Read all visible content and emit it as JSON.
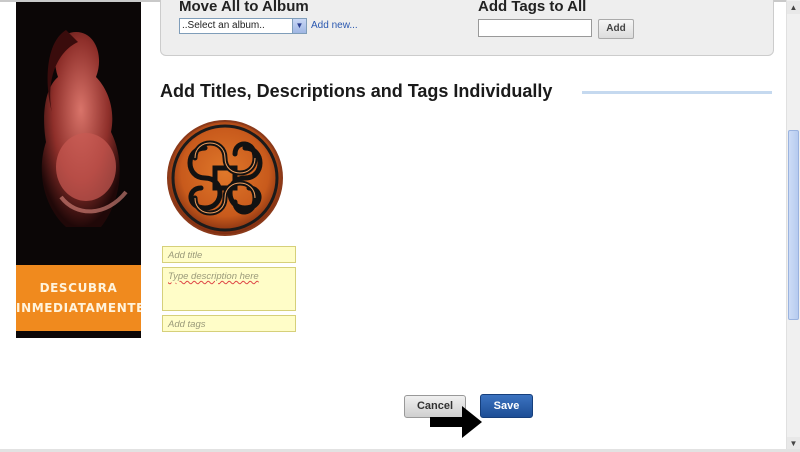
{
  "ad": {
    "line1": "DESCUBRA",
    "line2": "INMEDIATAMENTE"
  },
  "bulk": {
    "album_heading": "Move All to Album",
    "album_select_value": "..Select an album..",
    "add_new_link": "Add new...",
    "tags_heading": "Add Tags to All",
    "tags_input_value": "",
    "add_button": "Add"
  },
  "section": {
    "title": "Add Titles, Descriptions and Tags Individually"
  },
  "photo": {
    "title_placeholder": "Add title",
    "description_placeholder": "Type description here",
    "tags_placeholder": "Add tags"
  },
  "actions": {
    "cancel": "Cancel",
    "save": "Save"
  },
  "colors": {
    "ad_orange": "#f08a1e",
    "save_blue": "#1d4e96",
    "field_yellow": "#fffdc8",
    "rule_blue": "#c5d9ef"
  },
  "icons": {
    "arrow": "right-arrow-icon",
    "dropdown": "chevron-down-icon"
  }
}
